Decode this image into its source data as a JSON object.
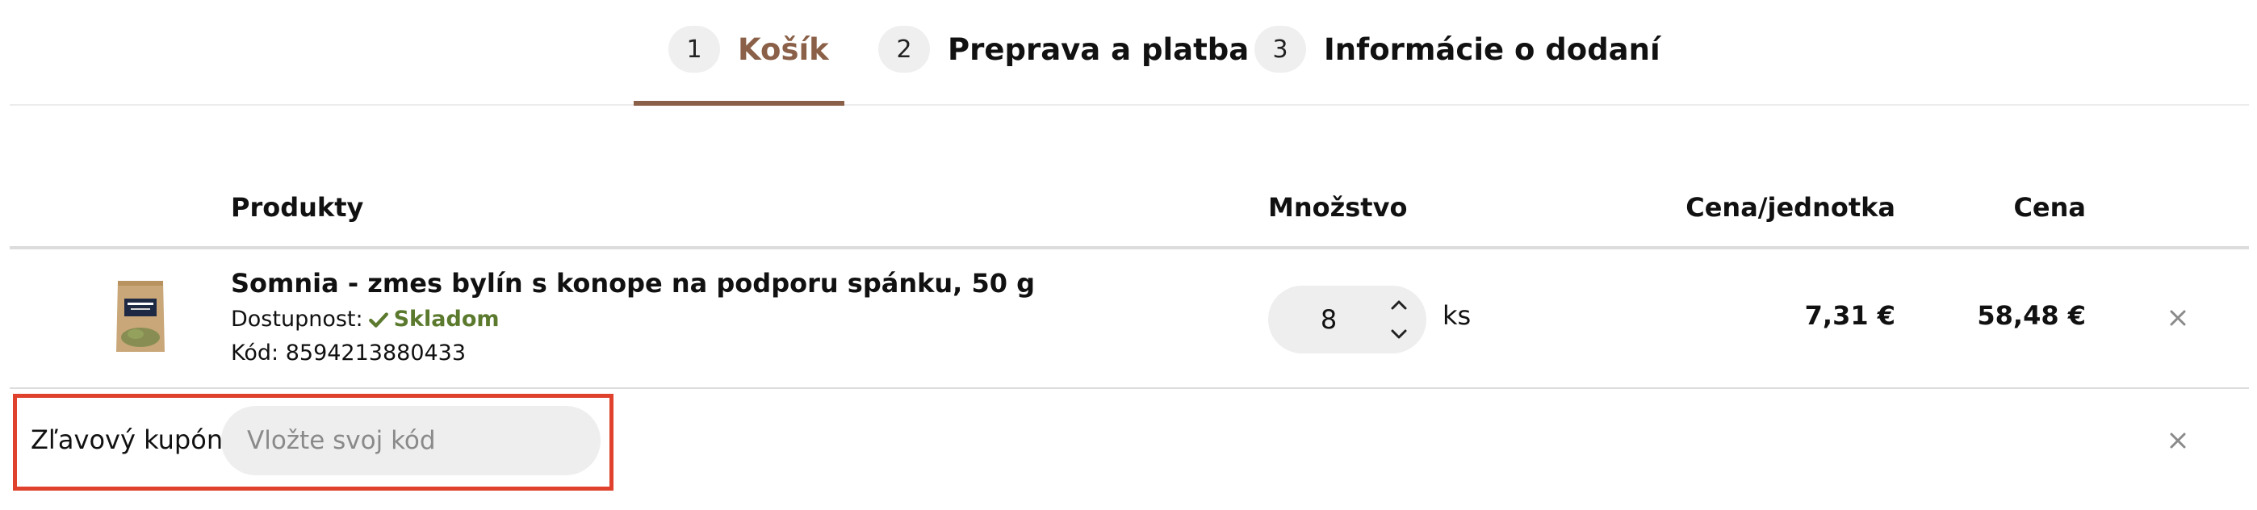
{
  "steps": [
    {
      "number": "1",
      "label": "Košík",
      "active": true
    },
    {
      "number": "2",
      "label": "Preprava a platba",
      "active": false
    },
    {
      "number": "3",
      "label": "Informácie o dodaní",
      "active": false
    }
  ],
  "table": {
    "headers": {
      "products": "Produkty",
      "quantity": "Množstvo",
      "unit_price": "Cena/jednotka",
      "price": "Cena"
    }
  },
  "item": {
    "name": "Somnia - zmes bylín s konope na podporu spánku, 50 g",
    "availability_label": "Dostupnost:",
    "availability_value": "Skladom",
    "code_label": "Kód:",
    "code": "8594213880433",
    "quantity": "8",
    "unit": "ks",
    "unit_price": "7,31 €",
    "price": "58,48 €"
  },
  "coupon": {
    "label": "Zľavový kupón",
    "placeholder": "Vložte svoj kód"
  },
  "colors": {
    "accent": "#8b6048",
    "in_stock": "#5b7a2e",
    "highlight": "#e0412c"
  },
  "icons": {
    "availability": "check-icon",
    "remove": "close-icon",
    "qty_up": "chevron-up-icon",
    "qty_down": "chevron-down-icon"
  }
}
